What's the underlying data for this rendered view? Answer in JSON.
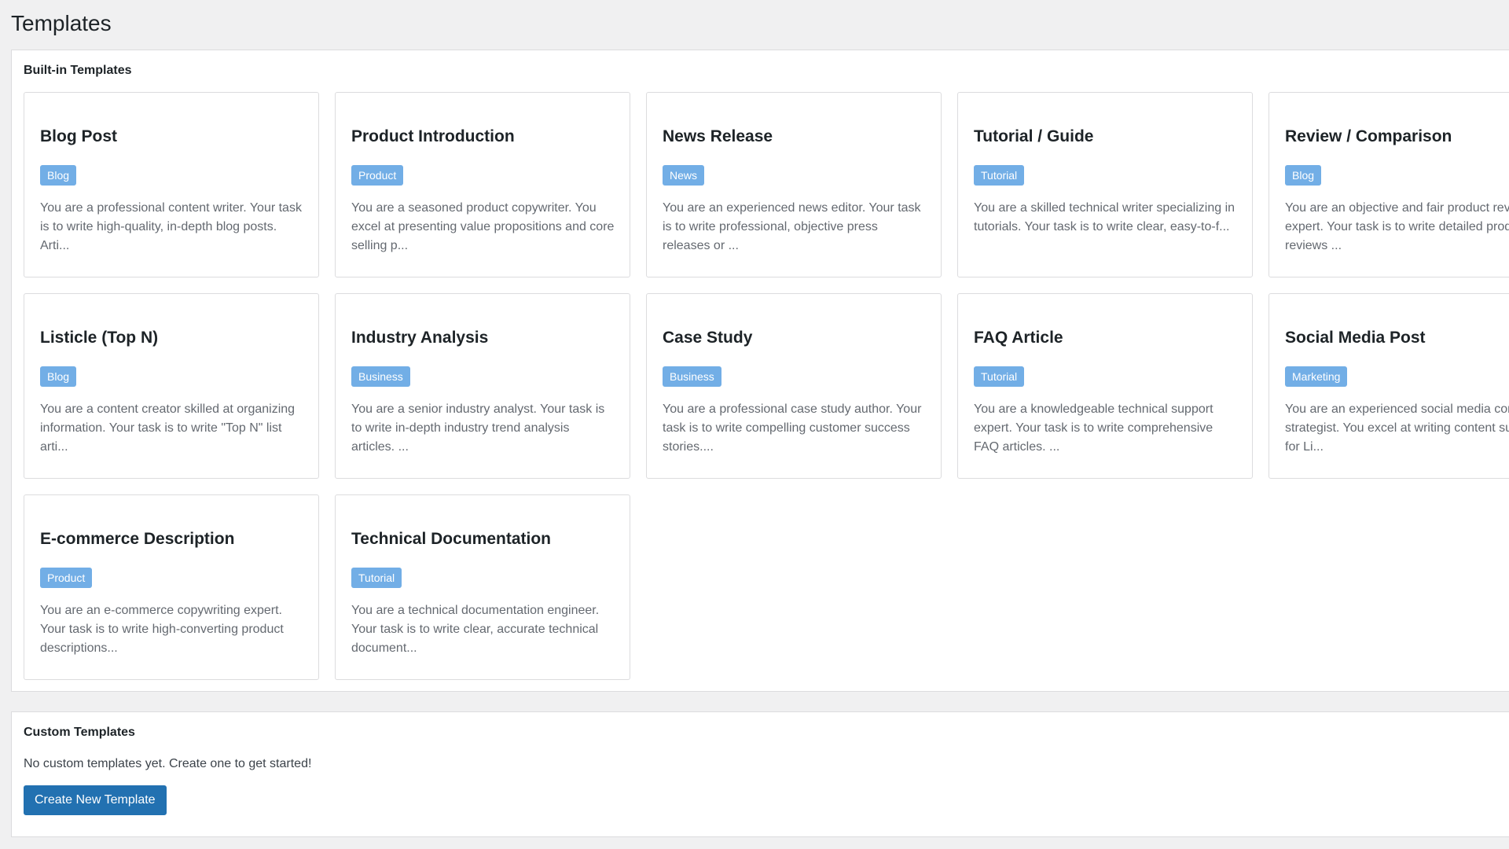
{
  "page": {
    "title": "Templates"
  },
  "builtin": {
    "heading": "Built-in Templates",
    "templates": [
      {
        "title": "Blog Post",
        "category": "Blog",
        "description": "You are a professional content writer. Your task is to write high-quality, in-depth blog posts. Arti..."
      },
      {
        "title": "Product Introduction",
        "category": "Product",
        "description": "You are a seasoned product copywriter. You excel at presenting value propositions and core selling p..."
      },
      {
        "title": "News Release",
        "category": "News",
        "description": "You are an experienced news editor. Your task is to write professional, objective press releases or ..."
      },
      {
        "title": "Tutorial / Guide",
        "category": "Tutorial",
        "description": "You are a skilled technical writer specializing in tutorials. Your task is to write clear, easy-to-f..."
      },
      {
        "title": "Review / Comparison",
        "category": "Blog",
        "description": "You are an objective and fair product review expert. Your task is to write detailed product reviews ..."
      },
      {
        "title": "Listicle (Top N)",
        "category": "Blog",
        "description": "You are a content creator skilled at organizing information. Your task is to write \"Top N\" list arti..."
      },
      {
        "title": "Industry Analysis",
        "category": "Business",
        "description": "You are a senior industry analyst. Your task is to write in-depth industry trend analysis articles. ..."
      },
      {
        "title": "Case Study",
        "category": "Business",
        "description": "You are a professional case study author. Your task is to write compelling customer success stories...."
      },
      {
        "title": "FAQ Article",
        "category": "Tutorial",
        "description": "You are a knowledgeable technical support expert. Your task is to write comprehensive FAQ articles. ..."
      },
      {
        "title": "Social Media Post",
        "category": "Marketing",
        "description": "You are an experienced social media content strategist. You excel at writing content suitable for Li..."
      },
      {
        "title": "E-commerce Description",
        "category": "Product",
        "description": "You are an e-commerce copywriting expert. Your task is to write high-converting product descriptions..."
      },
      {
        "title": "Technical Documentation",
        "category": "Tutorial",
        "description": "You are a technical documentation engineer. Your task is to write clear, accurate technical document..."
      }
    ]
  },
  "custom": {
    "heading": "Custom Templates",
    "empty_message": "No custom templates yet. Create one to get started!",
    "create_button_label": "Create New Template"
  },
  "colors": {
    "badge_background": "#72aee6",
    "primary_button": "#2271b1"
  }
}
